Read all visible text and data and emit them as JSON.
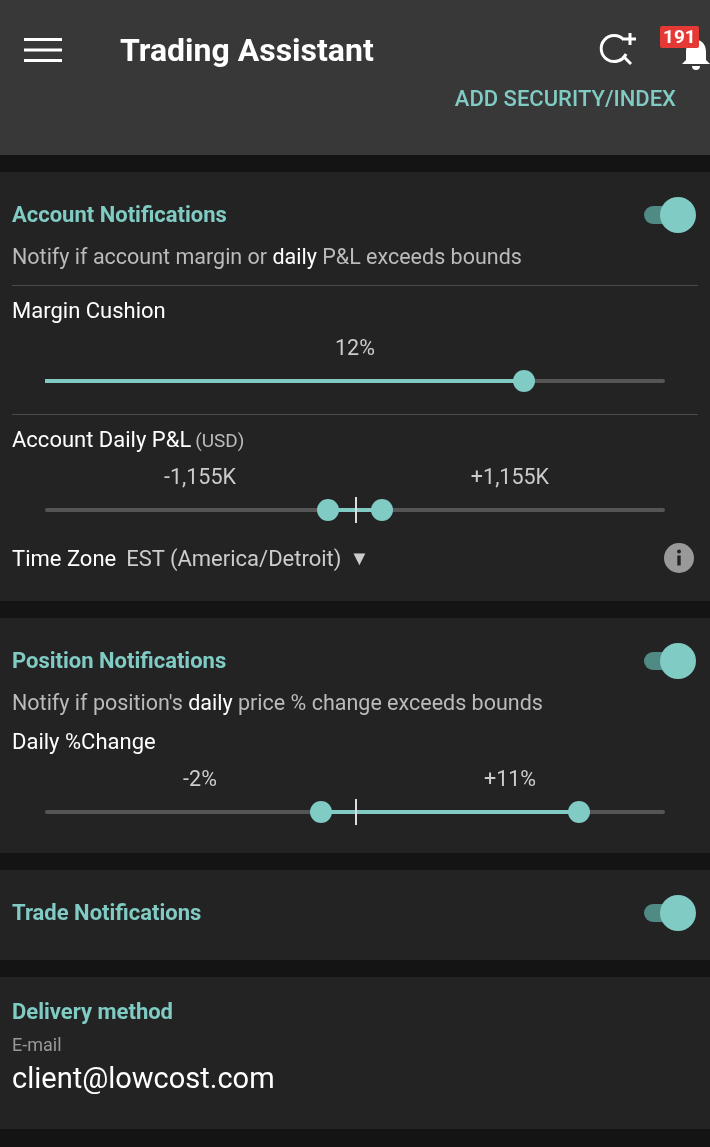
{
  "app_bar": {
    "title": "Trading Assistant",
    "badge": "191",
    "action": "ADD SECURITY/INDEX"
  },
  "account": {
    "title": "Account Notifications",
    "on": true,
    "description": "Notify if account margin or **daily** P&L exceeds bounds",
    "margin": {
      "label": "Margin Cushion",
      "reading": "12%",
      "level": 0.773
    },
    "pnl": {
      "label": "Account Daily P&L",
      "unit": "(USD)",
      "low_reading": "-1,155K",
      "high_reading": "+1,155K",
      "thumbs": [
        {
          "level": 0.456
        },
        {
          "level": 0.544
        }
      ]
    },
    "time_zone": {
      "label": "Time Zone",
      "value": "EST (America/Detroit)",
      "caret": "▼"
    }
  },
  "position": {
    "title": "Position Notifications",
    "on": true,
    "description": "Notify if position's **daily** price % change exceeds bounds",
    "change": {
      "label": "Daily %Change",
      "low_reading": "-2%",
      "high_reading": "+11%",
      "thumbs": [
        {
          "level": 0.445
        },
        {
          "level": 0.861
        }
      ]
    }
  },
  "trade": {
    "title": "Trade Notifications",
    "on": true
  },
  "delivery": {
    "title": "Delivery method",
    "field_label": "E-mail",
    "value": "client@lowcost.com"
  }
}
